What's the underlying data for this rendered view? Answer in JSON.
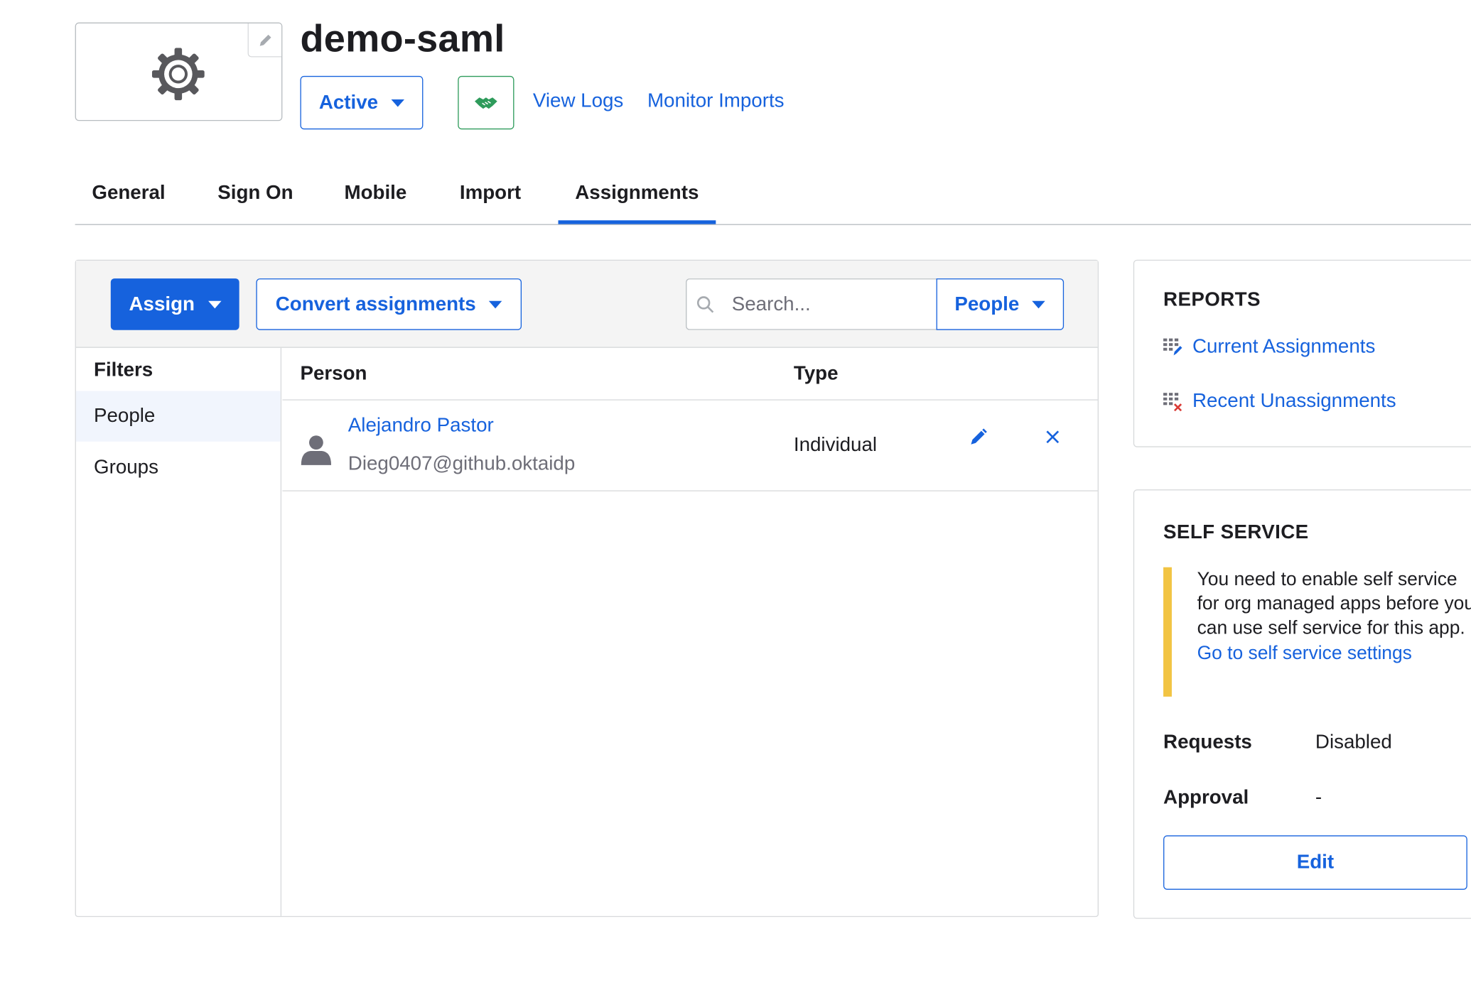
{
  "header": {
    "app_name": "demo-saml",
    "status_label": "Active",
    "view_logs": "View Logs",
    "monitor_imports": "Monitor Imports"
  },
  "tabs": [
    {
      "label": "General"
    },
    {
      "label": "Sign On"
    },
    {
      "label": "Mobile"
    },
    {
      "label": "Import"
    },
    {
      "label": "Assignments",
      "active": true
    }
  ],
  "toolbar": {
    "assign_label": "Assign",
    "convert_label": "Convert assignments",
    "search_placeholder": "Search...",
    "search_value": "",
    "scope_label": "People"
  },
  "filters": {
    "heading": "Filters",
    "items": [
      {
        "label": "People",
        "selected": true
      },
      {
        "label": "Groups",
        "selected": false
      }
    ]
  },
  "table": {
    "columns": [
      "Person",
      "Type"
    ],
    "rows": [
      {
        "name": "Alejandro Pastor",
        "email": "Dieg0407@github.oktaidp",
        "type": "Individual"
      }
    ]
  },
  "reports": {
    "heading": "REPORTS",
    "links": [
      "Current Assignments",
      "Recent Unassignments"
    ]
  },
  "self_service": {
    "heading": "SELF SERVICE",
    "notice": "You need to enable self service for org managed apps before you can use self service for this app.",
    "settings_link": "Go to self service settings",
    "requests_label": "Requests",
    "requests_value": "Disabled",
    "approval_label": "Approval",
    "approval_value": "-",
    "edit_label": "Edit"
  },
  "colors": {
    "primary": "#1662dd",
    "handshake_accent": "#2e9b5b",
    "warning_bar": "#f2c443",
    "remove_x": "#d93934"
  },
  "icons": [
    "gear-icon",
    "pencil-icon",
    "caret-down-icon",
    "handshake-icon",
    "search-icon",
    "person-icon",
    "close-icon",
    "grid-assign-icon",
    "grid-unassign-icon"
  ]
}
